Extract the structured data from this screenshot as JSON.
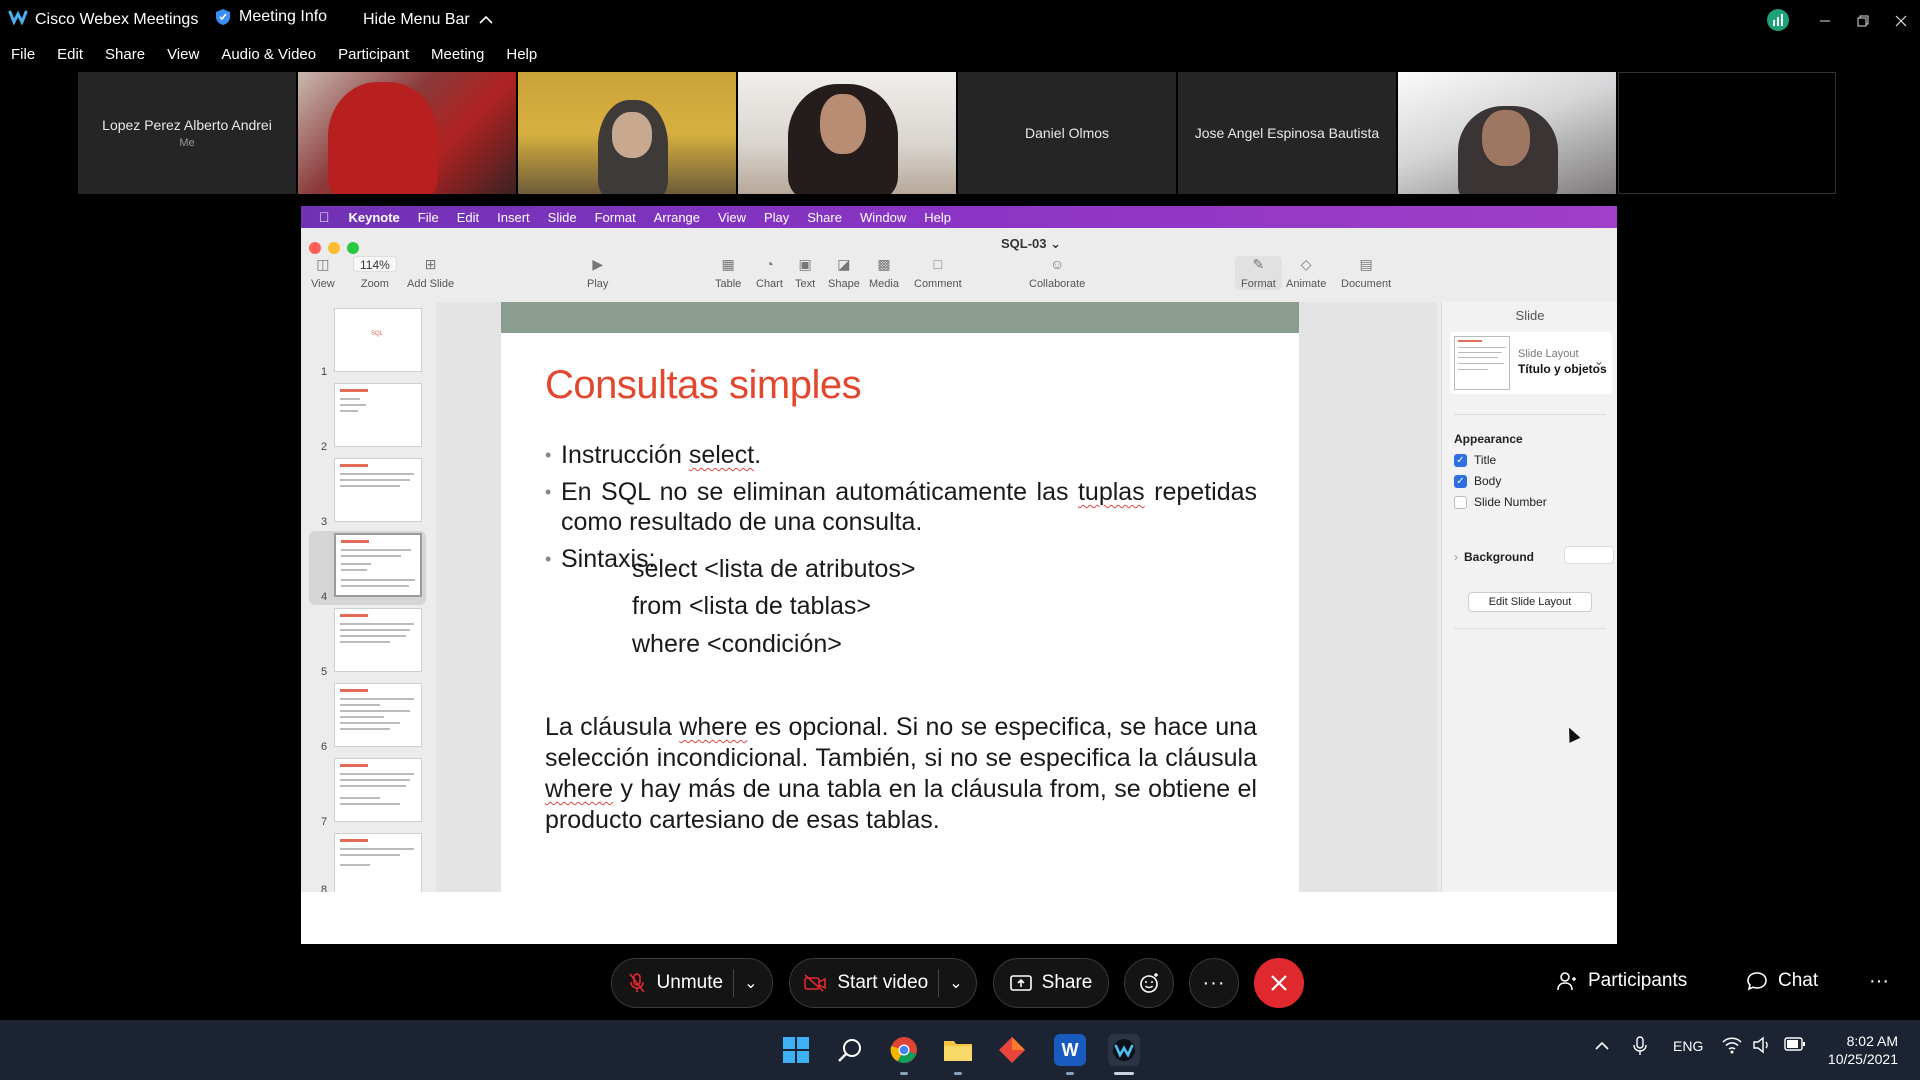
{
  "titlebar": {
    "app_name": "Cisco Webex Meetings",
    "meeting_info": "Meeting Info",
    "hide_menu_bar": "Hide Menu Bar"
  },
  "menu": [
    "File",
    "Edit",
    "Share",
    "View",
    "Audio & Video",
    "Participant",
    "Meeting",
    "Help"
  ],
  "participants": [
    {
      "name": "Lopez Perez Alberto Andrei",
      "sub": "Me",
      "video": false
    },
    {
      "name": "",
      "video": true
    },
    {
      "name": "",
      "video": true
    },
    {
      "name": "",
      "video": true
    },
    {
      "name": "Daniel Olmos",
      "video": false
    },
    {
      "name": "Jose Angel Espinosa Bautista",
      "video": false
    },
    {
      "name": "",
      "video": true
    },
    {
      "name": "",
      "video": false
    }
  ],
  "mac_menu": {
    "app": "Keynote",
    "items": [
      "File",
      "Edit",
      "Insert",
      "Slide",
      "Format",
      "Arrange",
      "View",
      "Play",
      "Share",
      "Window",
      "Help"
    ]
  },
  "keynote": {
    "doc_title": "SQL-03",
    "zoom": "114%",
    "toolbar": {
      "view": "View",
      "zoom": "Zoom",
      "add_slide": "Add Slide",
      "play": "Play",
      "table": "Table",
      "chart": "Chart",
      "text": "Text",
      "shape": "Shape",
      "media": "Media",
      "comment": "Comment",
      "collaborate": "Collaborate",
      "format": "Format",
      "animate": "Animate",
      "document": "Document"
    },
    "slide_numbers": [
      "1",
      "2",
      "3",
      "4",
      "5",
      "6",
      "7",
      "8"
    ],
    "thumb1_title": "SQL"
  },
  "slide": {
    "title": "Consultas simples",
    "bullet1_pre": "Instrucción ",
    "bullet1_sq": "select",
    "bullet1_post": ".",
    "bullet2_pre": "En SQL no se eliminan automáticamente las ",
    "bullet2_sq": "tuplas",
    "bullet2_post": " repetidas como resultado de una consulta.",
    "bullet3": "Sintaxis:",
    "code1": "select <lista de atributos>",
    "code2": "from <lista de tablas>",
    "code3": "where <condición>",
    "para_a": "La cláusula ",
    "para_sq1": "where",
    "para_b": " es opcional. Si no se especifica, se hace una selección incondicional. También, si no se especifica la cláusula ",
    "para_sq2": "where",
    "para_c": " y hay más de una tabla en la cláusula from, se obtiene el producto cartesiano de esas tablas."
  },
  "inspector": {
    "tab": "Slide",
    "layout_label": "Slide Layout",
    "layout_value": "Título y objetos",
    "appearance": "Appearance",
    "title_chk": "Title",
    "body_chk": "Body",
    "slide_number_chk": "Slide Number",
    "title_checked": true,
    "body_checked": true,
    "slide_number_checked": false,
    "background": "Background",
    "edit_layout": "Edit Slide Layout"
  },
  "controls": {
    "unmute": "Unmute",
    "start_video": "Start video",
    "share": "Share",
    "participants": "Participants",
    "chat": "Chat"
  },
  "taskbar": {
    "language": "ENG",
    "time": "8:02 AM",
    "date": "10/25/2021"
  },
  "colors": {
    "slide_title": "#e1482f",
    "mac_menubar": "#8b34c5",
    "end_call": "#e0282f",
    "checkbox_on": "#2f6fe0"
  }
}
